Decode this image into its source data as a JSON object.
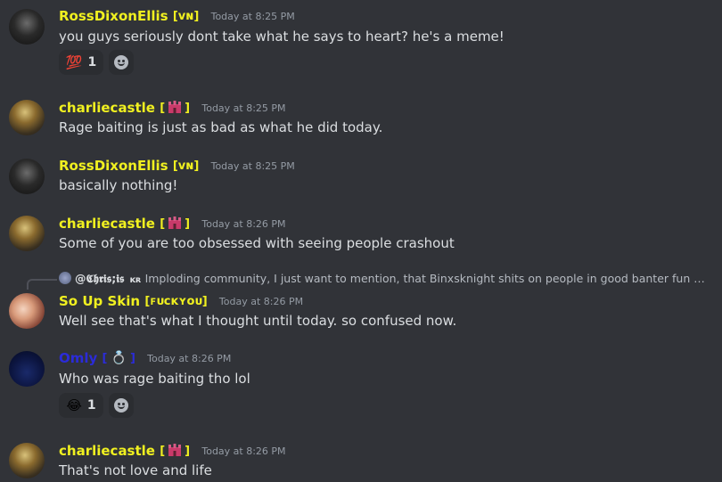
{
  "messages": [
    {
      "author": "RossDixonEllis",
      "tag": "[ᴠɴ]",
      "time": "Today at 8:25 PM",
      "text": "you guys seriously dont take what he says to heart? he's a meme!",
      "reaction": {
        "emoji": "💯",
        "count": "1"
      }
    },
    {
      "author": "charliecastle",
      "tag_open": "[",
      "tag_close": "]",
      "time": "Today at 8:25 PM",
      "text": "Rage baiting is just as bad as what he did today."
    },
    {
      "author": "RossDixonEllis",
      "tag": "[ᴠɴ]",
      "time": "Today at 8:25 PM",
      "text": "basically nothing!"
    },
    {
      "author": "charliecastle",
      "tag_open": "[",
      "tag_close": "]",
      "time": "Today at 8:26 PM",
      "text": "Some of you are too obsessed with seeing people crashout"
    },
    {
      "author": "So Up Skin",
      "tag": "[ꜰᴜᴄᴋʏᴏᴜ]",
      "time": "Today at 8:26 PM",
      "text": "Well see that's what I thought until today. so confused now.",
      "reply": {
        "name": "@𝕮𝖍𝖗𝖎𝖘;𝖎𝖘",
        "tag": "ᴋʀ",
        "text": "Imploding community, I just want to mention, that Binxsknight shits on people in good banter fun and ta..."
      }
    },
    {
      "author": "Omly",
      "tag_open": "[",
      "tag_close": "]",
      "time": "Today at 8:26 PM",
      "text": "Who was rage baiting tho lol",
      "reaction": {
        "emoji": "😂",
        "count": "1"
      }
    },
    {
      "author": "charliecastle",
      "tag_open": "[",
      "tag_close": "]",
      "time": "Today at 8:26 PM",
      "text": "That's not love and life"
    }
  ],
  "colors": {
    "background": "#313338",
    "yellow_name": "#f0f020",
    "blue_name": "#2b2bd8",
    "text": "#dbdee1",
    "timestamp": "#949ba4"
  },
  "icons": {
    "add_reaction": "smiley-add-icon",
    "castle": "castle-icon",
    "ring": "ring-icon"
  }
}
